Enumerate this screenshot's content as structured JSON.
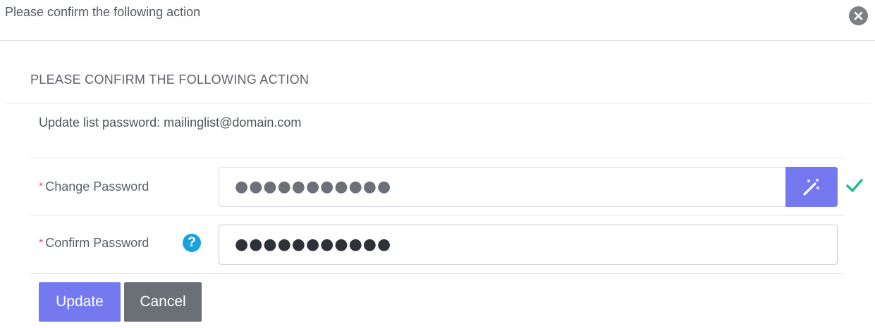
{
  "header": {
    "title": "Please confirm the following action",
    "close_icon": "close-circle-icon"
  },
  "form": {
    "heading": "PLEASE CONFIRM THE FOLLOWING ACTION",
    "description": "Update list password: mailinglist@domain.com",
    "required_marker": "*",
    "change_password": {
      "label": "Change Password",
      "value": "●●●●●●●●●●●",
      "generate_icon": "magic-wand-icon",
      "valid_icon": "check-icon"
    },
    "confirm_password": {
      "label": "Confirm Password",
      "value": "●●●●●●●●●●●",
      "help_icon": "question-circle-icon",
      "help_glyph": "?"
    }
  },
  "buttons": {
    "update_label": "Update",
    "cancel_label": "Cancel"
  },
  "colors": {
    "primary": "#7579f0",
    "secondary": "#6a7075",
    "required": "#f0506e",
    "help": "#1ba3d8",
    "valid": "#1fbf8f"
  }
}
